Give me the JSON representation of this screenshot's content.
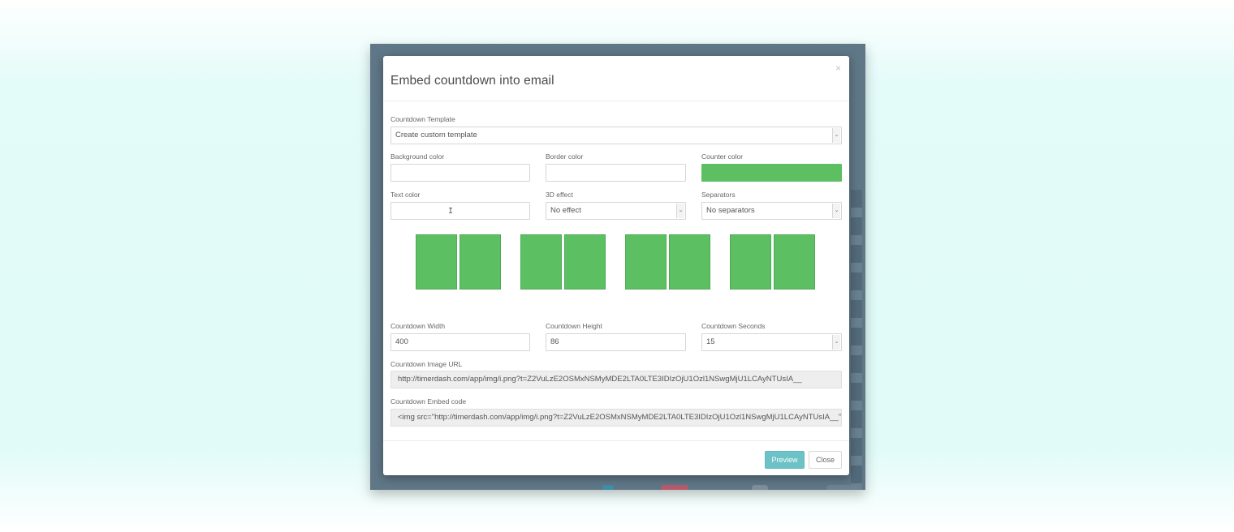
{
  "modal": {
    "title": "Embed countdown into email",
    "close_glyph": "×"
  },
  "form": {
    "template": {
      "label": "Countdown Template",
      "value": "Create custom template"
    },
    "background_color": {
      "label": "Background color",
      "value": ""
    },
    "border_color": {
      "label": "Border color",
      "value": ""
    },
    "counter_color": {
      "label": "Counter color",
      "value": "#5cbf62"
    },
    "text_color": {
      "label": "Text color",
      "value": ""
    },
    "effect_3d": {
      "label": "3D effect",
      "value": "No effect"
    },
    "separators": {
      "label": "Separators",
      "value": "No separators"
    },
    "width": {
      "label": "Countdown Width",
      "value": "400"
    },
    "height": {
      "label": "Countdown Height",
      "value": "86"
    },
    "seconds": {
      "label": "Countdown Seconds",
      "value": "15"
    },
    "image_url": {
      "label": "Countdown Image URL",
      "value": "http://timerdash.com/app/img/i.png?t=Z2VuLzE2OSMxNSMyMDE2LTA0LTE3IDIzOjU1Ozl1NSwgMjU1LCAyNTUsIA__"
    },
    "embed_code": {
      "label": "Countdown Embed code",
      "value": "<img src=\"http://timerdash.com/app/img/i.png?t=Z2VuLzE2OSMxNSMyMDE2LTA0LTE3IDIzOjU1Ozl1NSwgMjU1LCAyNTUsIA__\" alt=\""
    }
  },
  "preview": {
    "digit_color": "#5cbf62"
  },
  "footer": {
    "preview_label": "Preview",
    "close_label": "Close"
  },
  "icons": {
    "dropdown": "chevron-down-icon",
    "close": "close-icon",
    "cursor": "text-cursor-icon"
  }
}
